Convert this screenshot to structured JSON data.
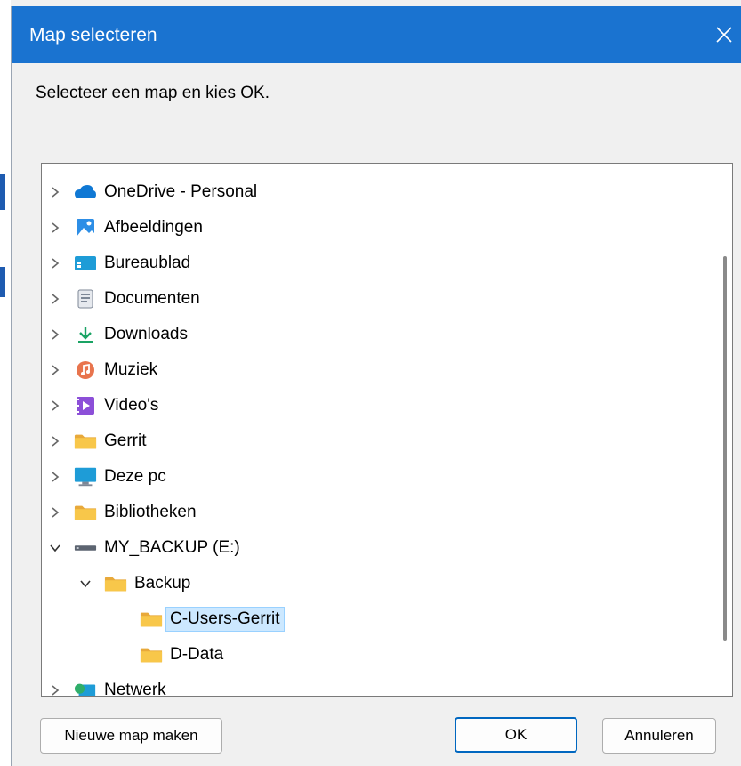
{
  "dialog": {
    "title": "Map selecteren",
    "instruction": "Selecteer een map en kies OK."
  },
  "tree": {
    "items": [
      {
        "label": "OneDrive - Personal",
        "icon": "cloud-icon",
        "expanded": false,
        "level": 0
      },
      {
        "label": "Afbeeldingen",
        "icon": "pictures-icon",
        "expanded": false,
        "level": 0
      },
      {
        "label": "Bureaublad",
        "icon": "desktop-icon",
        "expanded": false,
        "level": 0
      },
      {
        "label": "Documenten",
        "icon": "documents-icon",
        "expanded": false,
        "level": 0
      },
      {
        "label": "Downloads",
        "icon": "download-icon",
        "expanded": false,
        "level": 0
      },
      {
        "label": "Muziek",
        "icon": "music-icon",
        "expanded": false,
        "level": 0
      },
      {
        "label": "Video's",
        "icon": "video-icon",
        "expanded": false,
        "level": 0
      },
      {
        "label": "Gerrit",
        "icon": "folder-icon",
        "expanded": false,
        "level": 0
      },
      {
        "label": "Deze pc",
        "icon": "computer-icon",
        "expanded": false,
        "level": 0
      },
      {
        "label": "Bibliotheken",
        "icon": "folder-icon",
        "expanded": false,
        "level": 0
      },
      {
        "label": "MY_BACKUP (E:)",
        "icon": "drive-icon",
        "expanded": true,
        "level": 0
      },
      {
        "label": "Backup",
        "icon": "folder-icon",
        "expanded": true,
        "level": 1
      },
      {
        "label": "C-Users-Gerrit",
        "icon": "folder-icon",
        "selected": true,
        "level": 2
      },
      {
        "label": "D-Data",
        "icon": "folder-icon",
        "level": 2
      },
      {
        "label": "Netwerk",
        "icon": "network-icon",
        "expanded": false,
        "level": 0
      }
    ]
  },
  "buttons": {
    "new_folder": "Nieuwe map maken",
    "ok": "OK",
    "cancel": "Annuleren"
  },
  "colors": {
    "titlebar": "#1a73d0",
    "selection": "#cce8ff",
    "accent": "#0067c0",
    "folder": "#f8c74a"
  }
}
